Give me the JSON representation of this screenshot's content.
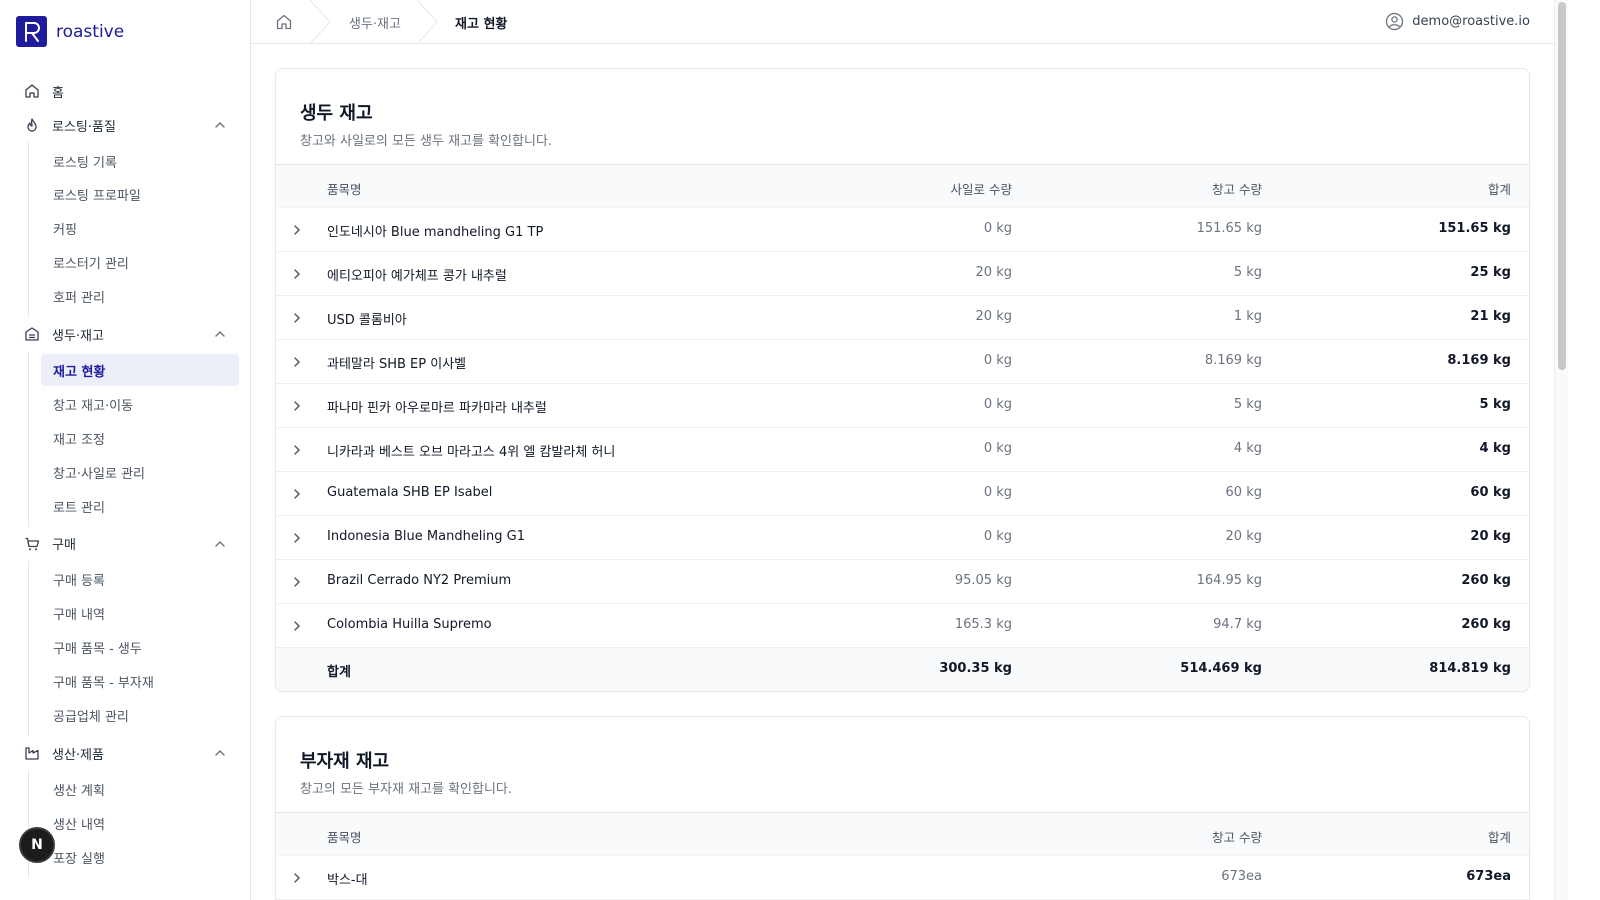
{
  "brand": {
    "name": "roastive",
    "mark": "R"
  },
  "nav": {
    "home": "홈",
    "groups": [
      {
        "label": "로스팅·품질",
        "icon": "flame-icon",
        "items": [
          "로스팅 기록",
          "로스팅 프로파일",
          "커핑",
          "로스터기 관리",
          "호퍼 관리"
        ]
      },
      {
        "label": "생두·재고",
        "icon": "warehouse-icon",
        "items": [
          "재고 현황",
          "창고 재고·이동",
          "재고 조정",
          "창고·사일로 관리",
          "로트 관리"
        ],
        "active": "재고 현황"
      },
      {
        "label": "구매",
        "icon": "cart-icon",
        "items": [
          "구매 등록",
          "구매 내역",
          "구매 품목 - 생두",
          "구매 품목 - 부자재",
          "공급업체 관리"
        ]
      },
      {
        "label": "생산·제품",
        "icon": "factory-icon",
        "items": [
          "생산 계획",
          "생산 내역",
          "포장 실행"
        ]
      }
    ],
    "float_label": "N"
  },
  "header": {
    "breadcrumb": [
      "생두·재고",
      "재고 현황"
    ],
    "user_email": "demo@roastive.io"
  },
  "green_stock": {
    "title": "생두 재고",
    "description": "창고와 사일로의 모든 생두 재고를 확인합니다.",
    "columns": [
      "품목명",
      "사일로 수량",
      "창고 수량",
      "합계"
    ],
    "rows": [
      {
        "name": "인도네시아 Blue mandheling G1 TP",
        "silo": "0 kg",
        "warehouse": "151.65 kg",
        "total": "151.65 kg"
      },
      {
        "name": "에티오피아 예가체프 콩가 내추럴",
        "silo": "20 kg",
        "warehouse": "5 kg",
        "total": "25 kg"
      },
      {
        "name": "USD 콜롬비아",
        "silo": "20 kg",
        "warehouse": "1 kg",
        "total": "21 kg"
      },
      {
        "name": "과테말라 SHB EP 이사벨",
        "silo": "0 kg",
        "warehouse": "8.169 kg",
        "total": "8.169 kg"
      },
      {
        "name": "파나마 핀카 아우로마르 파카마라 내추럴",
        "silo": "0 kg",
        "warehouse": "5 kg",
        "total": "5 kg"
      },
      {
        "name": "니카라과 베스트 오브 마라고스 4위 엘 캄발라체 허니",
        "silo": "0 kg",
        "warehouse": "4 kg",
        "total": "4 kg"
      },
      {
        "name": "Guatemala SHB EP Isabel",
        "silo": "0 kg",
        "warehouse": "60 kg",
        "total": "60 kg"
      },
      {
        "name": "Indonesia Blue Mandheling G1",
        "silo": "0 kg",
        "warehouse": "20 kg",
        "total": "20 kg"
      },
      {
        "name": "Brazil Cerrado NY2 Premium",
        "silo": "95.05 kg",
        "warehouse": "164.95 kg",
        "total": "260 kg"
      },
      {
        "name": "Colombia Huilla Supremo",
        "silo": "165.3 kg",
        "warehouse": "94.7 kg",
        "total": "260 kg"
      }
    ],
    "sum": {
      "name": "합계",
      "silo": "300.35 kg",
      "warehouse": "514.469 kg",
      "total": "814.819 kg"
    }
  },
  "sub_stock": {
    "title": "부자재 재고",
    "description": "창고의 모든 부자재 재고를 확인합니다.",
    "columns": [
      "품목명",
      "창고 수량",
      "합계"
    ],
    "rows": [
      {
        "name": "박스-대",
        "warehouse": "673ea",
        "total": "673ea"
      }
    ]
  },
  "colors": {
    "brand": "#1e1b9e",
    "active_bg": "#eceef8",
    "border": "#e5e7eb"
  }
}
